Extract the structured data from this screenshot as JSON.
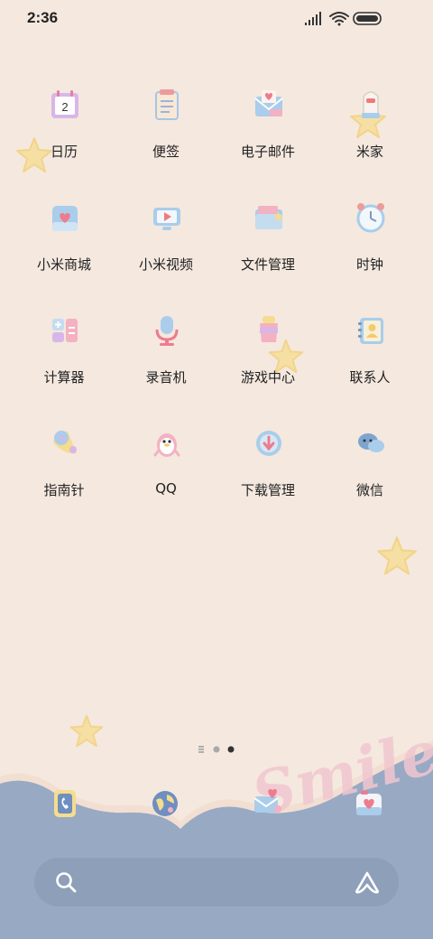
{
  "status": {
    "time": "2:36"
  },
  "apps": [
    {
      "label": "日历",
      "icon": "calendar-icon",
      "badge": "2"
    },
    {
      "label": "便签",
      "icon": "notes-icon"
    },
    {
      "label": "电子邮件",
      "icon": "email-icon"
    },
    {
      "label": "米家",
      "icon": "mijia-icon"
    },
    {
      "label": "小米商城",
      "icon": "store-icon"
    },
    {
      "label": "小米视频",
      "icon": "video-icon"
    },
    {
      "label": "文件管理",
      "icon": "file-manager-icon"
    },
    {
      "label": "时钟",
      "icon": "clock-icon"
    },
    {
      "label": "计算器",
      "icon": "calculator-icon"
    },
    {
      "label": "录音机",
      "icon": "recorder-icon"
    },
    {
      "label": "游戏中心",
      "icon": "game-center-icon"
    },
    {
      "label": "联系人",
      "icon": "contacts-icon"
    },
    {
      "label": "指南针",
      "icon": "compass-icon"
    },
    {
      "label": "QQ",
      "icon": "qq-icon"
    },
    {
      "label": "下载管理",
      "icon": "download-icon"
    },
    {
      "label": "微信",
      "icon": "wechat-icon"
    }
  ],
  "dock": [
    "phone-icon",
    "browser-icon",
    "messages-icon",
    "camera-icon"
  ],
  "wallpaper_text": "Smile",
  "page_indicator": {
    "pages": 3,
    "current": 3
  },
  "colors": {
    "background": "#f4e8df",
    "dock": "#98a9c4",
    "search": "#8e9fb9"
  }
}
